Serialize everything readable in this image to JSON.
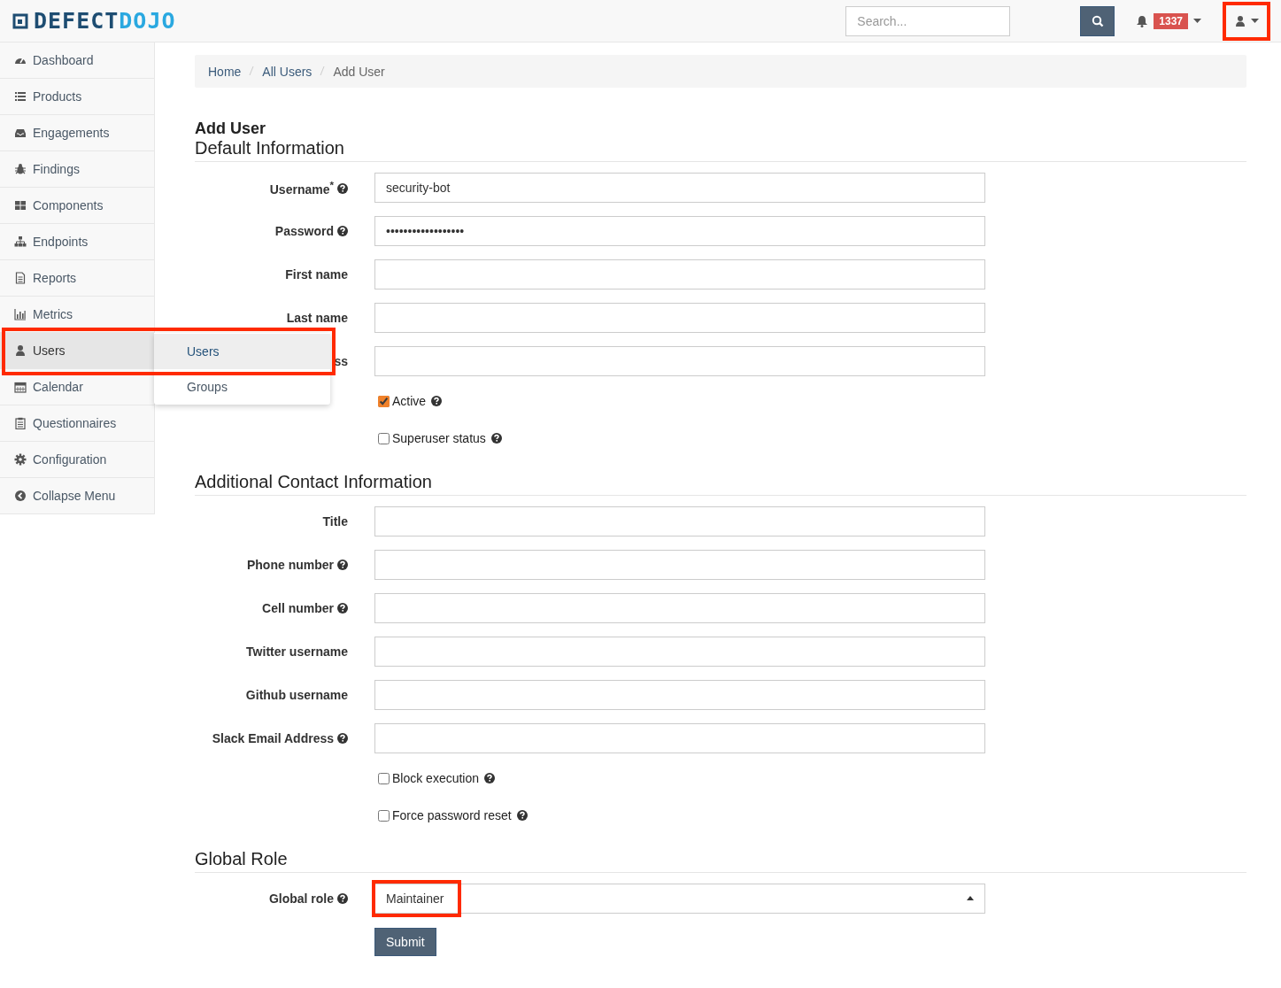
{
  "logo": {
    "first": "DEFECT",
    "second": "DOJO"
  },
  "topbar": {
    "search": {
      "placeholder": "Search..."
    },
    "alerts": {
      "count": "1337"
    },
    "user_menu": {
      "highlighted": true
    }
  },
  "sidebar": {
    "items": [
      {
        "label": "Dashboard",
        "selected": false
      },
      {
        "label": "Products",
        "selected": false
      },
      {
        "label": "Engagements",
        "selected": false
      },
      {
        "label": "Findings",
        "selected": false
      },
      {
        "label": "Components",
        "selected": false
      },
      {
        "label": "Endpoints",
        "selected": false
      },
      {
        "label": "Reports",
        "selected": false
      },
      {
        "label": "Metrics",
        "selected": false
      },
      {
        "label": "Users",
        "selected": true,
        "highlighted": true,
        "submenu": [
          {
            "label": "Users",
            "selected": true
          },
          {
            "label": "Groups",
            "selected": false
          }
        ]
      },
      {
        "label": "Calendar",
        "selected": false
      },
      {
        "label": "Questionnaires",
        "selected": false
      },
      {
        "label": "Configuration",
        "selected": false
      },
      {
        "label": "Collapse Menu",
        "selected": false
      }
    ]
  },
  "breadcrumb": [
    {
      "label": "Home",
      "kind": "link"
    },
    {
      "label": "All Users",
      "kind": "link"
    },
    {
      "label": "Add User",
      "kind": "current"
    }
  ],
  "page_title": "Add User",
  "sections": [
    {
      "title": "Default Information",
      "fields": [
        {
          "kind": "text",
          "label": "Username$^{*}$",
          "help": true,
          "value": "security-bot"
        },
        {
          "kind": "text",
          "label": "Password",
          "help": true,
          "value": "••••••••••••••••••"
        },
        {
          "kind": "text",
          "label": "First name",
          "help": false
        },
        {
          "kind": "text",
          "label": "Last name",
          "help": false
        },
        {
          "kind": "text",
          "label": "ss",
          "help": false
        },
        {
          "kind": "checkbox",
          "label": "Active",
          "help": true,
          "checked": true
        },
        {
          "kind": "checkbox",
          "label": "Superuser status",
          "help": true,
          "checked": false
        }
      ]
    },
    {
      "title": "Additional Contact Information",
      "fields": [
        {
          "kind": "text",
          "label": "Title",
          "help": false
        },
        {
          "kind": "text",
          "label": "Phone number",
          "help": true
        },
        {
          "kind": "text",
          "label": "Cell number",
          "help": true
        },
        {
          "kind": "text",
          "label": "Twitter username",
          "help": false
        },
        {
          "kind": "text",
          "label": "Github username",
          "help": false
        },
        {
          "kind": "text",
          "label": "Slack Email Address",
          "help": true
        },
        {
          "kind": "checkbox",
          "label": "Block execution",
          "help": true,
          "checked": false
        },
        {
          "kind": "checkbox",
          "label": "Force password reset",
          "help": true,
          "checked": false
        }
      ]
    },
    {
      "title": "Global Role",
      "fields": [
        {
          "kind": "select",
          "label": "Global role",
          "help": true,
          "value": "Maintainer",
          "highlighted": true
        }
      ]
    }
  ],
  "submit": "Submit"
}
